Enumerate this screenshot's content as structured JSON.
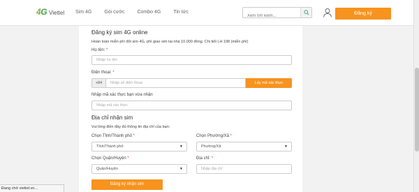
{
  "header": {
    "logo": {
      "part1": "4",
      "part2": "G",
      "brand": "Viettel"
    },
    "nav": [
      "Sim 4G",
      "Gói cước",
      "Combo 4G",
      "Tin tức"
    ],
    "search_placeholder": "Xem tìm kiếm...",
    "register_label": "Đăng ký"
  },
  "form": {
    "title": "Đăng ký sim 4G online",
    "description": "Hoàn toàn miễn phí đổi sim 4G, phí giao sim tại nhà 10.000 đồng. Chi tiết LH 198 (miễn phí)",
    "name": {
      "label": "Họ tên:",
      "required": "*",
      "placeholder": "Nhập họ tên"
    },
    "phone": {
      "label": "Điện thoại:",
      "required": "*",
      "prefix": "+84",
      "placeholder": "Nhập số điện thoại",
      "otp_button": "Lấy mã xác thực"
    },
    "otp": {
      "label": "Nhập mã xác thực bạn vừa nhận",
      "placeholder": "Nhập mã xác thực"
    },
    "address_title": "Địa chỉ nhận sim",
    "address_desc": "Vui lòng điền đầy đủ thông tin địa chỉ của bạn:",
    "province": {
      "label": "Chọn Tỉnh/Thành phố",
      "required": "*",
      "value": "Tỉnh/Thành phố"
    },
    "ward": {
      "label": "Chọn Phường/Xã",
      "required": "*",
      "value": "Phường/Xã"
    },
    "district": {
      "label": "Chọn Quận/Huyện",
      "required": "*",
      "value": "Quận/Huyện"
    },
    "address": {
      "label": "Địa chỉ:",
      "required": "*",
      "placeholder": "Nhập địa chỉ"
    },
    "submit_label": "Đăng ký nhận sim"
  },
  "status_bar": "Đang chờ viettel.vn...",
  "colors": {
    "accent": "#f7931e",
    "logo_green": "#7cb342"
  }
}
